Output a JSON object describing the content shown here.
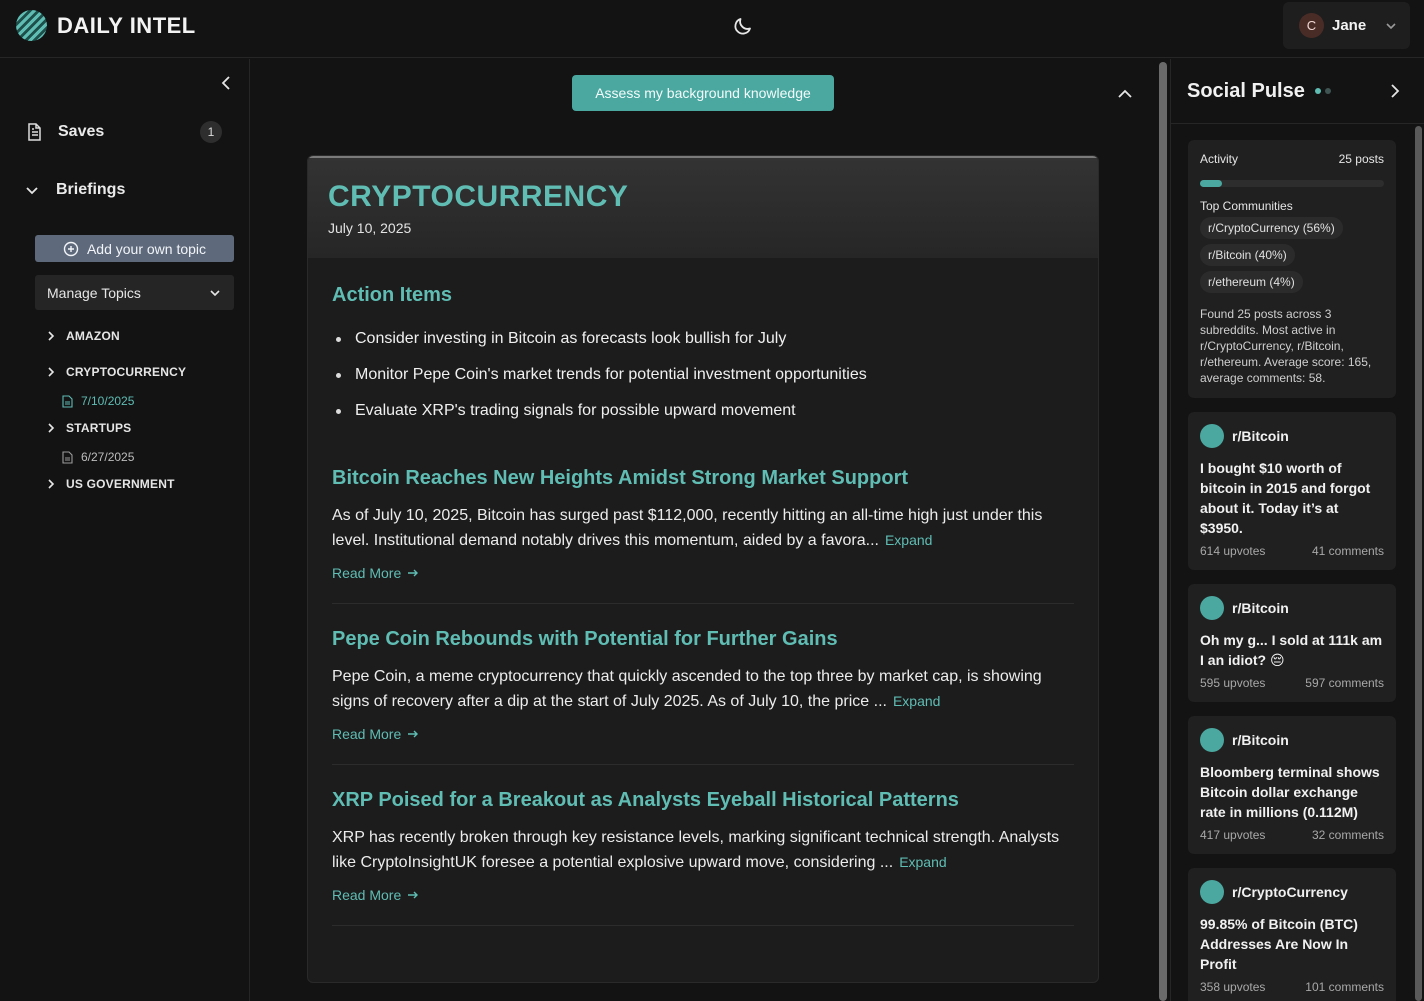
{
  "app": {
    "name": "DAILY INTEL"
  },
  "header": {
    "user_initial": "C",
    "user_name": "Jane"
  },
  "sidebar": {
    "saves_label": "Saves",
    "saves_count": "1",
    "briefings_label": "Briefings",
    "add_topic_label": "Add your own topic",
    "manage_topics_label": "Manage Topics",
    "topics": [
      {
        "label": "AMAZON"
      },
      {
        "label": "CRYPTOCURRENCY",
        "date": "7/10/2025"
      },
      {
        "label": "STARTUPS",
        "date": "6/27/2025"
      },
      {
        "label": "US GOVERNMENT"
      }
    ]
  },
  "main": {
    "assess_label": "Assess my background knowledge",
    "topic_title": "CRYPTOCURRENCY",
    "topic_date": "July 10, 2025",
    "action_items_title": "Action Items",
    "action_items": [
      "Consider investing in Bitcoin as forecasts look bullish for July",
      "Monitor Pepe Coin's market trends for potential investment opportunities",
      "Evaluate XRP's trading signals for possible upward movement"
    ],
    "expand_label": "Expand",
    "read_more_label": "Read More",
    "articles": [
      {
        "title": "Bitcoin Reaches New Heights Amidst Strong Market Support",
        "text": "As of July 10, 2025, Bitcoin has surged past $112,000, recently hitting an all-time high just under this level. Institutional demand notably drives this momentum, aided by a favora..."
      },
      {
        "title": "Pepe Coin Rebounds with Potential for Further Gains",
        "text": "Pepe Coin, a meme cryptocurrency that quickly ascended to the top three by market cap, is showing signs of recovery after a dip at the start of July 2025. As of July 10, the price ..."
      },
      {
        "title": "XRP Poised for a Breakout as Analysts Eyeball Historical Patterns",
        "text": "XRP has recently broken through key resistance levels, marking significant technical strength. Analysts like CryptoInsightUK foresee a potential explosive upward move, considering ..."
      }
    ]
  },
  "social": {
    "title": "Social Pulse",
    "activity_label": "Activity",
    "posts_count": "25 posts",
    "activity_fraction": 0.12,
    "top_communities_label": "Top Communities",
    "communities": [
      "r/CryptoCurrency (56%)",
      "r/Bitcoin (40%)",
      "r/ethereum (4%)"
    ],
    "summary": "Found 25 posts across 3 subreddits. Most active in r/CryptoCurrency, r/Bitcoin, r/ethereum. Average score: 165, average comments: 58.",
    "posts": [
      {
        "subreddit": "r/Bitcoin",
        "title": "I bought $10 worth of bitcoin in 2015 and forgot about it. Today it’s at $3950.",
        "upvotes": "614 upvotes",
        "comments": "41 comments"
      },
      {
        "subreddit": "r/Bitcoin",
        "title": "Oh my g... I sold at 111k am I an idiot? 😔",
        "upvotes": "595 upvotes",
        "comments": "597 comments"
      },
      {
        "subreddit": "r/Bitcoin",
        "title": "Bloomberg terminal shows Bitcoin dollar exchange rate in millions (0.112M)",
        "upvotes": "417 upvotes",
        "comments": "32 comments"
      },
      {
        "subreddit": "r/CryptoCurrency",
        "title": "99.85% of Bitcoin (BTC) Addresses Are Now In Profit",
        "upvotes": "358 upvotes",
        "comments": "101 comments"
      }
    ]
  },
  "colors": {
    "accent": "#5fbdb4",
    "button": "#4aa8a0",
    "add_topic": "#5e6a7c"
  },
  "icons": [
    "logo-icon",
    "moon-icon",
    "chevron-down-icon",
    "chevron-left-icon",
    "document-icon",
    "plus-circle-icon",
    "chevron-right-icon",
    "chevron-up-icon",
    "arrow-right-icon"
  ]
}
